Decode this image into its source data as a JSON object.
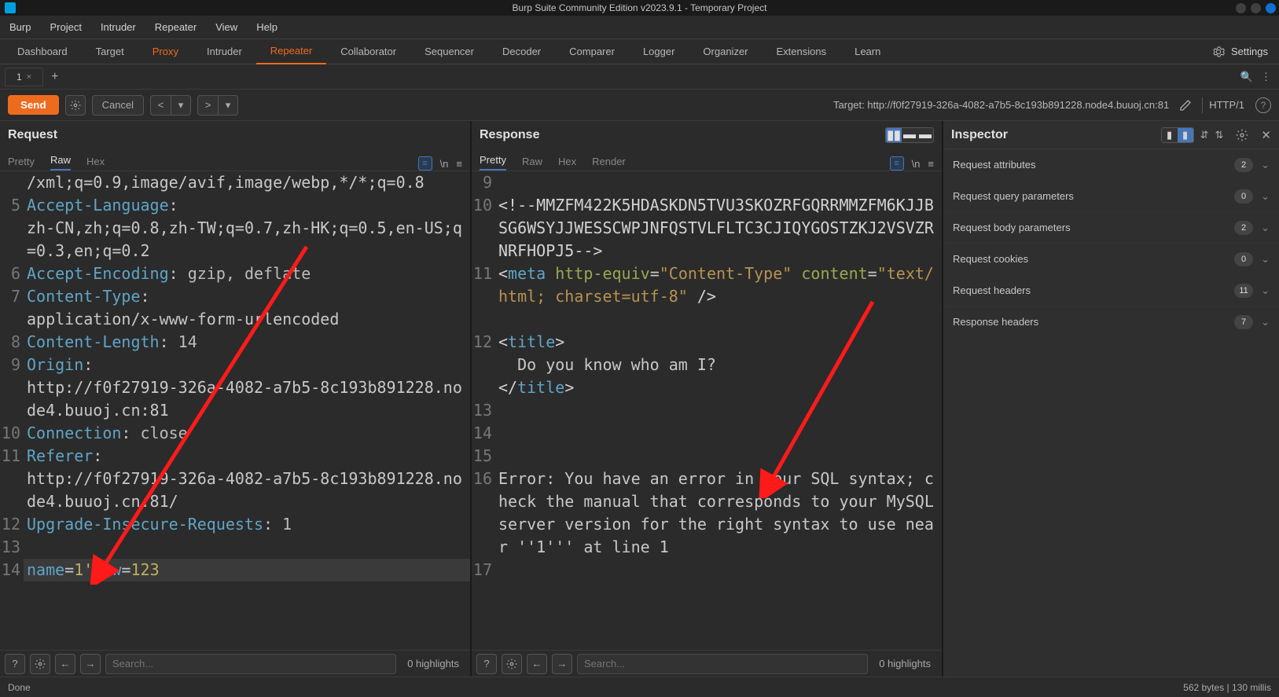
{
  "titlebar": "Burp Suite Community Edition v2023.9.1 - Temporary Project",
  "menubar": [
    "Burp",
    "Project",
    "Intruder",
    "Repeater",
    "View",
    "Help"
  ],
  "tooltabs": [
    "Dashboard",
    "Target",
    "Proxy",
    "Intruder",
    "Repeater",
    "Collaborator",
    "Sequencer",
    "Decoder",
    "Comparer",
    "Logger",
    "Organizer",
    "Extensions",
    "Learn"
  ],
  "tooltabs_active": "Repeater",
  "tooltabs_highlight": "Proxy",
  "settings_label": "Settings",
  "subtab": {
    "label": "1",
    "close": "×"
  },
  "action": {
    "send": "Send",
    "cancel": "Cancel",
    "target_prefix": "Target: ",
    "target": "http://f0f27919-326a-4082-a7b5-8c193b891228.node4.buuoj.cn:81",
    "proto": "HTTP/1"
  },
  "request": {
    "title": "Request",
    "tabs": [
      "Pretty",
      "Raw",
      "Hex"
    ],
    "active": "Raw",
    "lines": [
      {
        "n": "",
        "html": "/xml;q=0.9,image/avif,image/webp,*/*;q=0.8"
      },
      {
        "n": "5",
        "html": "<span class='hdr'>Accept-Language</span>: "
      },
      {
        "n": "",
        "html": "zh-CN,zh;q=0.8,zh-TW;q=0.7,zh-HK;q=0.5,en-US;q=0.3,en;q=0.2"
      },
      {
        "n": "6",
        "html": "<span class='hdr'>Accept-Encoding</span>: <span class='val'>gzip, deflate</span>"
      },
      {
        "n": "7",
        "html": "<span class='hdr'>Content-Type</span>: "
      },
      {
        "n": "",
        "html": "application/x-www-form-urlencoded"
      },
      {
        "n": "8",
        "html": "<span class='hdr'>Content-Length</span>: <span class='val'>14</span>"
      },
      {
        "n": "9",
        "html": "<span class='hdr'>Origin</span>: "
      },
      {
        "n": "",
        "html": "http://f0f27919-326a-4082-a7b5-8c193b891228.node4.buuoj.cn:81"
      },
      {
        "n": "10",
        "html": "<span class='hdr'>Connection</span>: <span class='val'>close</span>"
      },
      {
        "n": "11",
        "html": "<span class='hdr'>Referer</span>: "
      },
      {
        "n": "",
        "html": "http://f0f27919-326a-4082-a7b5-8c193b891228.node4.buuoj.cn:81/"
      },
      {
        "n": "12",
        "html": "<span class='hdr'>Upgrade-Insecure-Requests</span>: <span class='val'>1</span>"
      },
      {
        "n": "13",
        "html": ""
      },
      {
        "n": "14",
        "html": "<span class='param'>name</span>=<span class='pval'>1'</span>&<span class='param'>pw</span>=<span class='pval'>123</span>",
        "hl": true
      }
    ],
    "search_placeholder": "Search...",
    "highlights": "0 highlights"
  },
  "response": {
    "title": "Response",
    "tabs": [
      "Pretty",
      "Raw",
      "Hex",
      "Render"
    ],
    "active": "Pretty",
    "lines": [
      {
        "n": "9",
        "html": ""
      },
      {
        "n": "10",
        "html": "<span class='br'>&lt;!--MMZFM422K5HDASKDN5TVU3SKOZRFGQRRMMZFM6KJJBSG6WSYJJWESSCWPJNFQSTVLFLTC3CJIQYGOSTZKJ2VSVZRNRFHOPJ5--&gt;</span>"
      },
      {
        "n": "11",
        "html": "<span class='br'>&lt;</span><span class='tag'>meta</span> <span class='attr'>http-equiv</span>=<span class='str'>\"Content-Type\"</span> <span class='attr'>content</span>=<span class='str'>\"text/html; charset=utf-8\"</span> <span class='br'>/&gt;</span>"
      },
      {
        "n": "",
        "html": ""
      },
      {
        "n": "12",
        "html": "<span class='br'>&lt;</span><span class='tag'>title</span><span class='br'>&gt;</span>"
      },
      {
        "n": "",
        "html": "&nbsp;&nbsp;Do you know who am I?"
      },
      {
        "n": "",
        "html": "<span class='br'>&lt;/</span><span class='tag'>title</span><span class='br'>&gt;</span>"
      },
      {
        "n": "13",
        "html": ""
      },
      {
        "n": "14",
        "html": ""
      },
      {
        "n": "15",
        "html": ""
      },
      {
        "n": "16",
        "html": "Error: You have an error in your SQL syntax; check the manual that corresponds to your MySQL server version for the right syntax to use near ''1''' at line 1"
      },
      {
        "n": "17",
        "html": ""
      }
    ],
    "search_placeholder": "Search...",
    "highlights": "0 highlights"
  },
  "inspector": {
    "title": "Inspector",
    "sections": [
      {
        "label": "Request attributes",
        "count": 2
      },
      {
        "label": "Request query parameters",
        "count": 0
      },
      {
        "label": "Request body parameters",
        "count": 2
      },
      {
        "label": "Request cookies",
        "count": 0
      },
      {
        "label": "Request headers",
        "count": 11
      },
      {
        "label": "Response headers",
        "count": 7
      }
    ]
  },
  "status": {
    "left": "Done",
    "right": "562 bytes | 130 millis"
  }
}
